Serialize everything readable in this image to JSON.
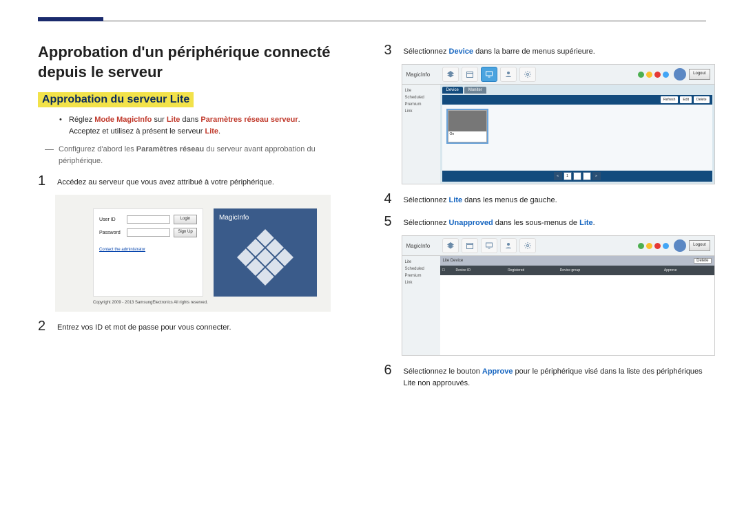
{
  "header": {
    "title": "Approbation d'un périphérique connecté depuis le serveur",
    "subhead": "Approbation du serveur Lite"
  },
  "intro": {
    "bullet_pre": "Réglez ",
    "bullet_red1": "Mode MagicInfo",
    "bullet_mid1": " sur ",
    "bullet_red2": "Lite",
    "bullet_mid2": " dans ",
    "bullet_red3": "Paramètres réseau serveur",
    "bullet_post": ".",
    "bullet_line2a": "Acceptez et utilisez à présent le serveur ",
    "bullet_line2_red": "Lite",
    "bullet_line2b": ".",
    "note_pre": "Configurez d'abord les ",
    "note_strong": "Paramètres réseau",
    "note_post": " du serveur avant approbation du périphérique."
  },
  "steps": {
    "s1": {
      "num": "1",
      "text": "Accédez au serveur que vous avez attribué à votre périphérique."
    },
    "s2": {
      "num": "2",
      "text": "Entrez vos ID et mot de passe pour vous connecter."
    },
    "s3": {
      "num": "3",
      "pre": "Sélectionnez ",
      "kw": "Device",
      "post": " dans la barre de menus supérieure."
    },
    "s4": {
      "num": "4",
      "pre": "Sélectionnez ",
      "kw": "Lite",
      "post": " dans les menus de gauche."
    },
    "s5": {
      "num": "5",
      "pre": "Sélectionnez ",
      "kw": "Unapproved",
      "post": " dans les sous-menus de ",
      "kw2": "Lite",
      "post2": "."
    },
    "s6": {
      "num": "6",
      "pre": "Sélectionnez le bouton ",
      "kw": "Approve",
      "post": " pour le périphérique visé dans la liste des périphériques Lite non approuvés."
    }
  },
  "login_shot": {
    "user_label": "User ID",
    "pass_label": "Password",
    "login_btn": "Login",
    "signup_btn": "Sign Up",
    "contact": "Contact the administrator",
    "brand": "MagicInfo",
    "copyright": "Copyright 2009 - 2013 SamsungElectronics All rights reserved."
  },
  "app_shot": {
    "brand": "MagicInfo",
    "logout": "Logout",
    "side_title": "Lite",
    "side_items": [
      "Lite",
      "Scheduled",
      "Premium",
      "Link"
    ],
    "tab_device": "Device",
    "tab_monitor": "Moniter",
    "refresh": "Refresh",
    "edit": "Edit",
    "delete": "Delete",
    "dev_on": "On",
    "lite_device": "Lite Device",
    "list_cols": [
      "",
      "Device ID",
      "Registered",
      "Device group",
      "",
      "Approve"
    ]
  }
}
